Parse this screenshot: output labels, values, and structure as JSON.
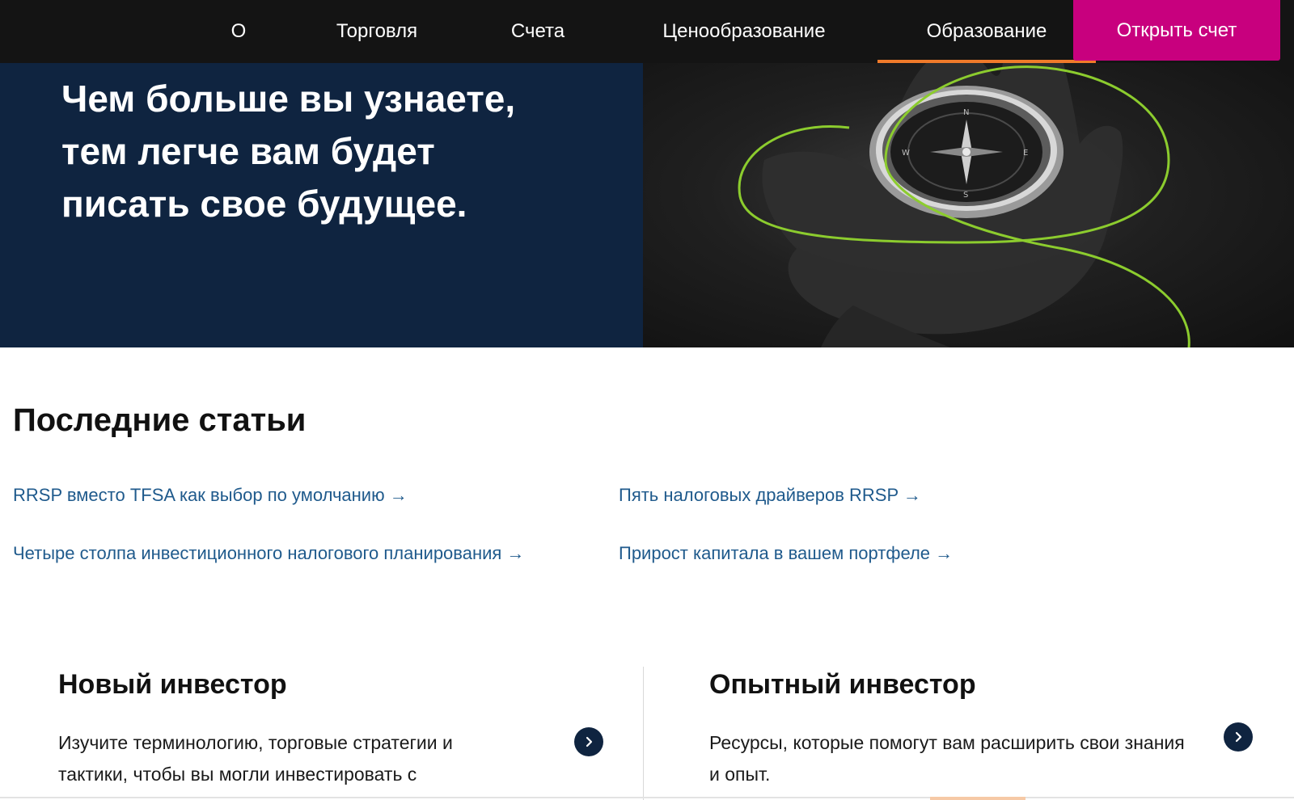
{
  "nav": {
    "items": [
      {
        "label": "О"
      },
      {
        "label": "Торговля"
      },
      {
        "label": "Счета"
      },
      {
        "label": "Ценообразование"
      },
      {
        "label": "Образование",
        "active": true
      }
    ],
    "cta_label": "Открыть счет"
  },
  "hero": {
    "lines": [
      "Чем больше вы узнаете,",
      "тем легче вам будет",
      "писать свое будущее."
    ]
  },
  "articles": {
    "title": "Последние статьи",
    "items": [
      {
        "label": "RRSP вместо TFSA как выбор по умолчанию →"
      },
      {
        "label": "Пять налоговых драйверов RRSP →"
      },
      {
        "label": "Четыре столпа инвестиционного налогового планирования →"
      },
      {
        "label": "Прирост капитала в вашем портфеле →"
      }
    ]
  },
  "cards": [
    {
      "title": "Новый инвестор",
      "text": "Изучите терминологию, торговые стратегии и тактики, чтобы вы могли инвестировать с"
    },
    {
      "title": "Опытный инвестор",
      "text": "Ресурсы, которые помогут вам расширить свои знания и опыт."
    }
  ],
  "colors": {
    "nav_bg": "#141414",
    "hero_left_bg": "#0f2440",
    "cta_bg": "#c8007e",
    "active_underline": "#f07a2a",
    "link": "#1f5a8c",
    "accent_line": "#8ccc2e"
  },
  "icons": {
    "card_arrow": "chevron-right-icon",
    "hero_image": "compass-in-hand-image"
  }
}
